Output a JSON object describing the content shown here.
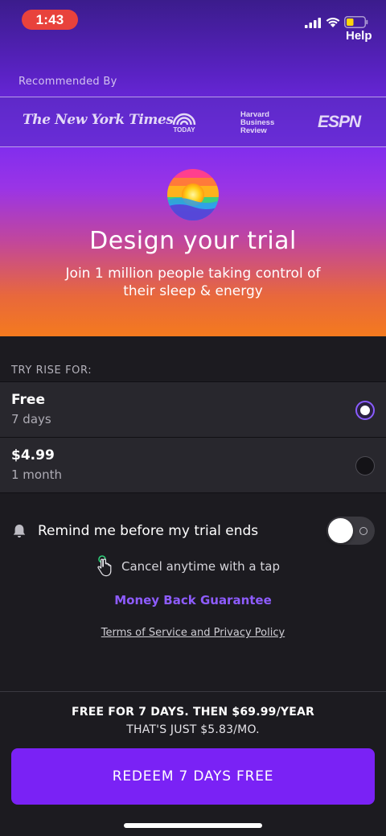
{
  "status_bar": {
    "time": "1:43",
    "help_label": "Help",
    "icons": [
      "signal-icon",
      "wifi-icon",
      "battery-icon"
    ]
  },
  "hero": {
    "recommended_label": "Recommended By",
    "press_logos": {
      "nyt": "The New York Times",
      "today": "TODAY",
      "hbr": [
        "Harvard",
        "Business",
        "Review"
      ],
      "espn": "ESPN"
    },
    "title": "Design your trial",
    "subtitle": "Join 1 million people taking control of their sleep & energy"
  },
  "trial": {
    "section_label": "TRY RISE FOR:",
    "options": [
      {
        "title": "Free",
        "subtitle": "7 days",
        "selected": true
      },
      {
        "title": "$4.99",
        "subtitle": "1 month",
        "selected": false
      }
    ]
  },
  "remind": {
    "label": "Remind me before my trial ends",
    "enabled": false
  },
  "cancel_text": "Cancel anytime with a tap",
  "money_back": "Money Back Guarantee",
  "terms_link": "Terms of Service and Privacy Policy",
  "footer": {
    "price_line1": "FREE FOR 7 DAYS. THEN $69.99/YEAR",
    "price_line2": "THAT'S JUST $5.83/MO.",
    "cta_label": "REDEEM 7 DAYS FREE"
  },
  "colors": {
    "accent": "#7a22f5",
    "link_accent": "#8e5cff",
    "time_pill": "#e8423c",
    "background": "#1c1b20",
    "option_bg": "#28272d"
  }
}
